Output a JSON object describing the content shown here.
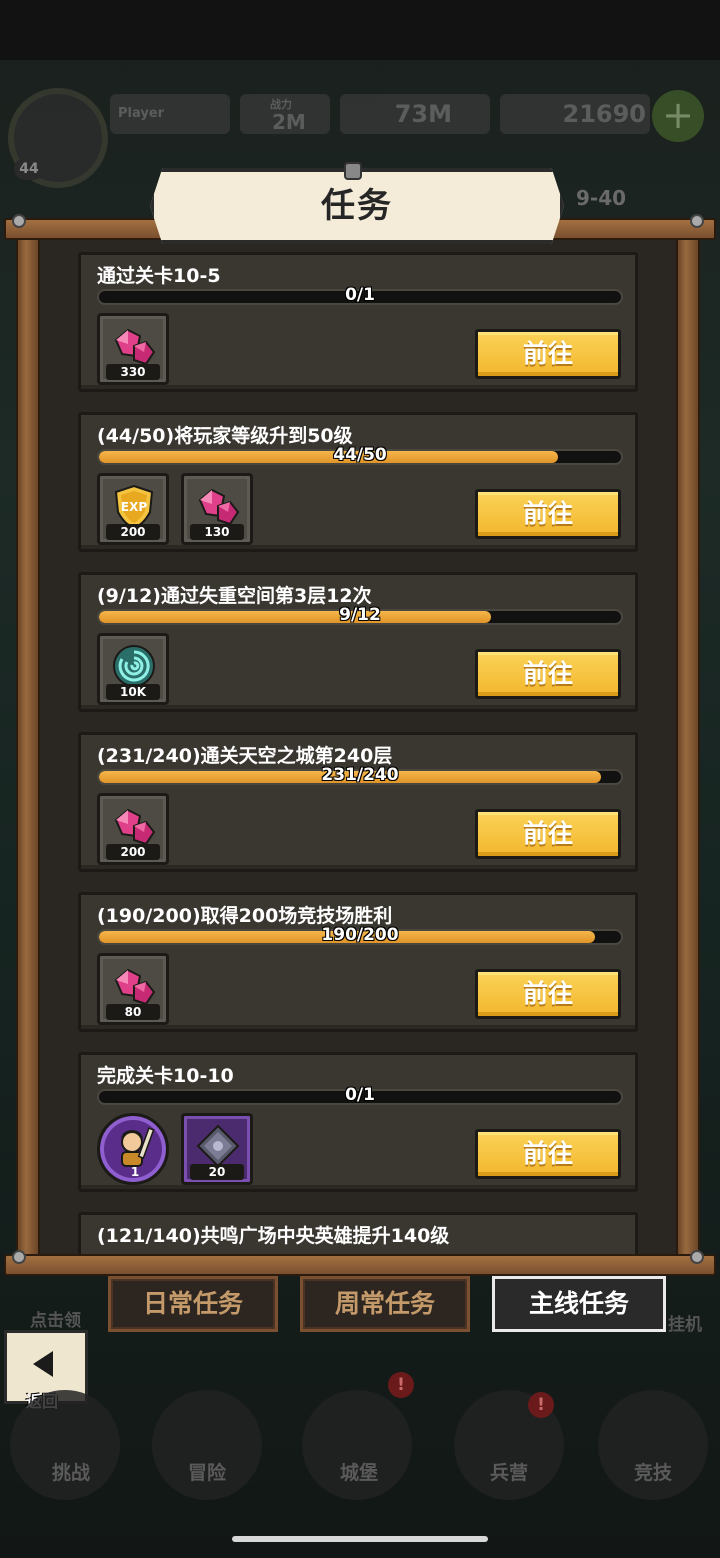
{
  "hud": {
    "player_name": "Player",
    "level": "44",
    "power_label": "战力",
    "power_value": "2M",
    "gold": "73M",
    "gems": "21690",
    "stage": "9-40"
  },
  "panel": {
    "title": "任务"
  },
  "quests": [
    {
      "title": "通过关卡10-5",
      "progress_text": "0/1",
      "progress": 0.0,
      "rewards": [
        {
          "icon": "gem-icon",
          "count": "330"
        }
      ],
      "button": "前往"
    },
    {
      "title": "(44/50)将玩家等级升到50级",
      "progress_text": "44/50",
      "progress": 0.88,
      "rewards": [
        {
          "icon": "exp-shield-icon",
          "count": "200"
        },
        {
          "icon": "gem-icon",
          "count": "130"
        }
      ],
      "button": "前往"
    },
    {
      "title": "(9/12)通过失重空间第3层12次",
      "progress_text": "9/12",
      "progress": 0.75,
      "rewards": [
        {
          "icon": "vortex-icon",
          "count": "10K"
        }
      ],
      "button": "前往"
    },
    {
      "title": "(231/240)通关天空之城第240层",
      "progress_text": "231/240",
      "progress": 0.9625,
      "rewards": [
        {
          "icon": "gem-icon",
          "count": "200"
        }
      ],
      "button": "前往"
    },
    {
      "title": "(190/200)取得200场竞技场胜利",
      "progress_text": "190/200",
      "progress": 0.95,
      "rewards": [
        {
          "icon": "gem-icon",
          "count": "80"
        }
      ],
      "button": "前往"
    },
    {
      "title": "完成关卡10-10",
      "progress_text": "0/1",
      "progress": 0.0,
      "rewards": [
        {
          "icon": "hero-portrait-icon",
          "count": "1"
        },
        {
          "icon": "rune-cube-icon",
          "count": "20"
        }
      ],
      "button": "前往"
    },
    {
      "title": "(121/140)共鸣广场中央英雄提升140级",
      "progress_text": "",
      "progress": 0.0,
      "rewards": [],
      "button": ""
    }
  ],
  "tabs": {
    "daily": "日常任务",
    "weekly": "周常任务",
    "main": "主线任务"
  },
  "back": {
    "label": "返回"
  },
  "side": {
    "left": "点击领",
    "right": "挂机"
  },
  "bottom_nav": [
    {
      "label": "挑战",
      "badge": ""
    },
    {
      "label": "冒险",
      "badge": ""
    },
    {
      "label": "城堡",
      "badge": "!"
    },
    {
      "label": "兵营",
      "badge": "!"
    },
    {
      "label": "竞技",
      "badge": ""
    }
  ],
  "colors": {
    "progress_fill": "#f2a93b",
    "button": "#f6c440",
    "gem": "#e0408a",
    "frame_wood": "#8a5a34"
  }
}
